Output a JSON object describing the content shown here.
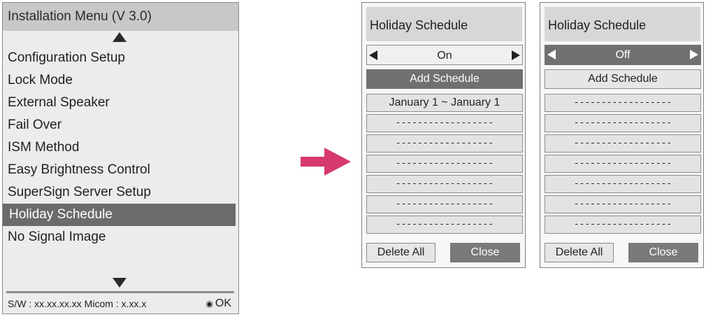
{
  "installation_menu": {
    "title": "Installation Menu (V 3.0)",
    "items": [
      {
        "label": "Configuration Setup"
      },
      {
        "label": "Lock Mode"
      },
      {
        "label": "External Speaker"
      },
      {
        "label": "Fail Over"
      },
      {
        "label": "ISM Method"
      },
      {
        "label": "Easy Brightness Control"
      },
      {
        "label": "SuperSign Server Setup"
      },
      {
        "label": "Holiday Schedule",
        "selected": true
      },
      {
        "label": "No Signal Image"
      }
    ],
    "footer_version": "S/W : xx.xx.xx.xx Micom : x.xx.x",
    "footer_ok": "OK",
    "ok_icon": "◉"
  },
  "transition_arrow": {
    "color": "#d63a6e"
  },
  "panels": [
    {
      "title": "Holiday Schedule",
      "toggle_value": "On",
      "add_schedule": "Add Schedule",
      "rows": [
        "January 1 ~ January 1",
        "------------------",
        "------------------",
        "------------------",
        "------------------",
        "------------------",
        "------------------"
      ],
      "delete_all": "Delete All",
      "close": "Close"
    },
    {
      "title": "Holiday Schedule",
      "toggle_value": "Off",
      "add_schedule": "Add Schedule",
      "rows": [
        "------------------",
        "------------------",
        "------------------",
        "------------------",
        "------------------",
        "------------------",
        "------------------"
      ],
      "delete_all": "Delete All",
      "close": "Close"
    }
  ]
}
